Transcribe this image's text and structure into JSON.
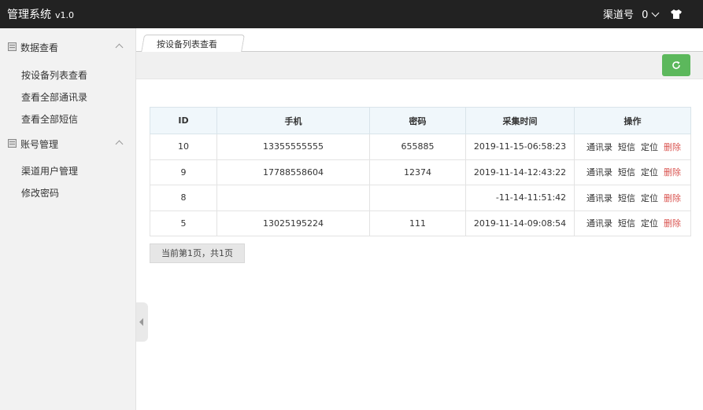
{
  "header": {
    "app_title": "管理系统",
    "version": "v1.0",
    "channel_label": "渠道号",
    "channel_value": "0"
  },
  "sidebar": {
    "groups": [
      {
        "title": "数据查看",
        "items": [
          "按设备列表查看",
          "查看全部通讯录",
          "查看全部短信"
        ]
      },
      {
        "title": "账号管理",
        "items": [
          "渠道用户管理",
          "修改密码"
        ]
      }
    ]
  },
  "tabs": [
    {
      "label": "按设备列表查看"
    }
  ],
  "table": {
    "headers": [
      "ID",
      "手机",
      "密码",
      "采集时间",
      "操作"
    ],
    "rows": [
      {
        "id": "10",
        "phone": "13355555555",
        "password": "655885",
        "time": "2019-11-15-06:58:23"
      },
      {
        "id": "9",
        "phone": "17788558604",
        "password": "12374",
        "time": "2019-11-14-12:43:22"
      },
      {
        "id": "8",
        "phone": "",
        "password": "",
        "time": "-11-14-11:51:42"
      },
      {
        "id": "5",
        "phone": "13025195224",
        "password": "111",
        "time": "2019-11-14-09:08:54"
      }
    ],
    "actions": [
      "通讯录",
      "短信",
      "定位",
      "删除"
    ]
  },
  "pagination": {
    "text": "当前第1页，共1页"
  },
  "colors": {
    "topbar": "#222222",
    "refresh_button": "#5cb85c",
    "delete_link": "#d9534f"
  },
  "icons": {
    "shirt": "shirt-icon",
    "refresh": "refresh-icon",
    "chevron": "chevron-down-icon"
  }
}
